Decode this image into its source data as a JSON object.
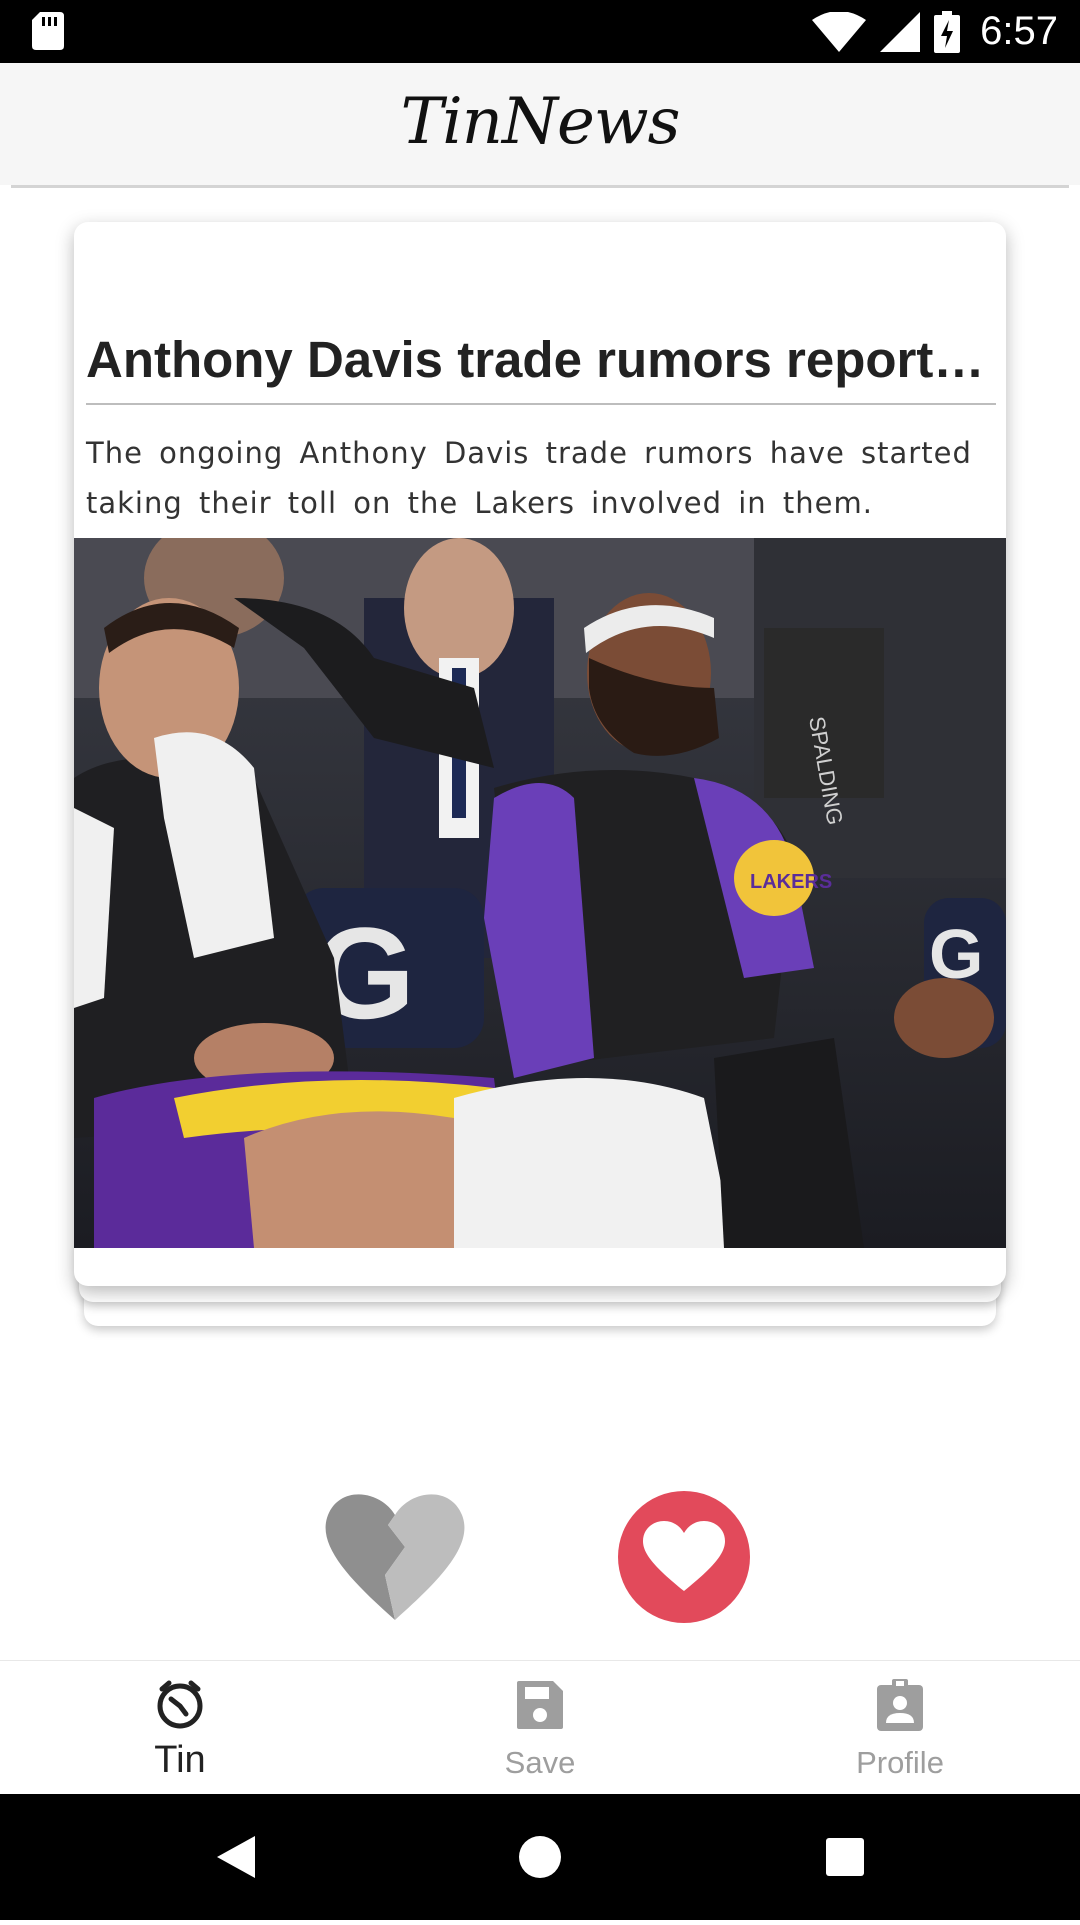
{
  "status_bar": {
    "time": "6:57",
    "icons": [
      "sd-card-icon",
      "wifi-icon",
      "signal-icon",
      "battery-charging-icon"
    ]
  },
  "header": {
    "title": "TinNews"
  },
  "card": {
    "title": "Anthony Davis trade rumors reported to be affecting Lakers",
    "description": "The ongoing Anthony Davis trade rumors have started taking their toll on the Lakers involved in them.",
    "image_alt": "Lakers players sitting on the bench"
  },
  "actions": {
    "dislike_icon": "broken-heart-icon",
    "like_icon": "heart-icon",
    "colors": {
      "like": "#e24a5b",
      "dislike": "#9e9e9e"
    }
  },
  "bottom_nav": {
    "items": [
      {
        "label": "Tin",
        "icon": "tin-icon",
        "active": true
      },
      {
        "label": "Save",
        "icon": "save-icon",
        "active": false
      },
      {
        "label": "Profile",
        "icon": "profile-icon",
        "active": false
      }
    ]
  },
  "system_nav": {
    "icons": [
      "back-icon",
      "home-icon",
      "recents-icon"
    ]
  }
}
